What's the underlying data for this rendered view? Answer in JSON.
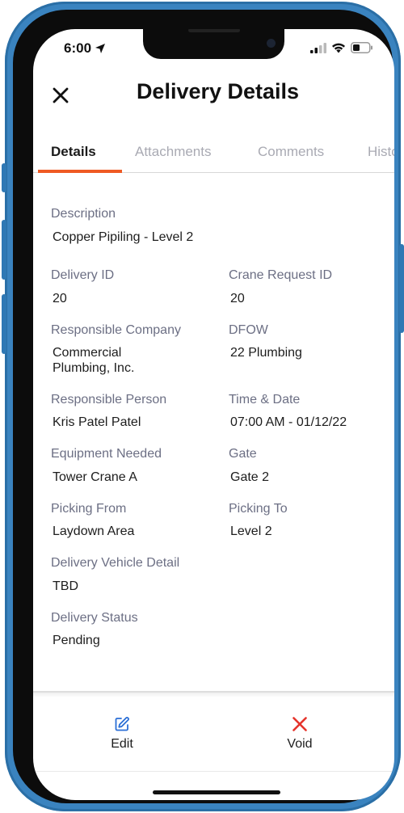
{
  "status_bar": {
    "time": "6:00"
  },
  "header": {
    "title": "Delivery Details"
  },
  "tabs": [
    {
      "label": "Details"
    },
    {
      "label": "Attachments"
    },
    {
      "label": "Comments"
    },
    {
      "label": "History"
    }
  ],
  "details": {
    "description_label": "Description",
    "description_value": "Copper Pipiling - Level 2",
    "delivery_id_label": "Delivery ID",
    "delivery_id_value": "20",
    "crane_request_id_label": "Crane Request ID",
    "crane_request_id_value": "20",
    "responsible_company_label": "Responsible Company",
    "responsible_company_value_line1": "Commercial",
    "responsible_company_value_line2": "Plumbing, Inc.",
    "dfow_label": "DFOW",
    "dfow_value": "22 Plumbing",
    "responsible_person_label": "Responsible Person",
    "responsible_person_value": "Kris Patel Patel",
    "time_date_label": "Time & Date",
    "time_date_value": "07:00 AM - 01/12/22",
    "equipment_needed_label": "Equipment Needed",
    "equipment_needed_value": "Tower Crane A",
    "gate_label": "Gate",
    "gate_value": "Gate 2",
    "picking_from_label": "Picking From",
    "picking_from_value": "Laydown Area",
    "picking_to_label": "Picking To",
    "picking_to_value": "Level 2",
    "vehicle_detail_label": "Delivery Vehicle Detail",
    "vehicle_detail_value": "TBD",
    "status_label": "Delivery Status",
    "status_value": "Pending"
  },
  "actions": {
    "edit_label": "Edit",
    "void_label": "Void"
  },
  "colors": {
    "accent": "#ef5a24",
    "edit_icon": "#2b6fd6",
    "void_icon": "#e5342c",
    "phone_frame": "#3a83bf"
  }
}
